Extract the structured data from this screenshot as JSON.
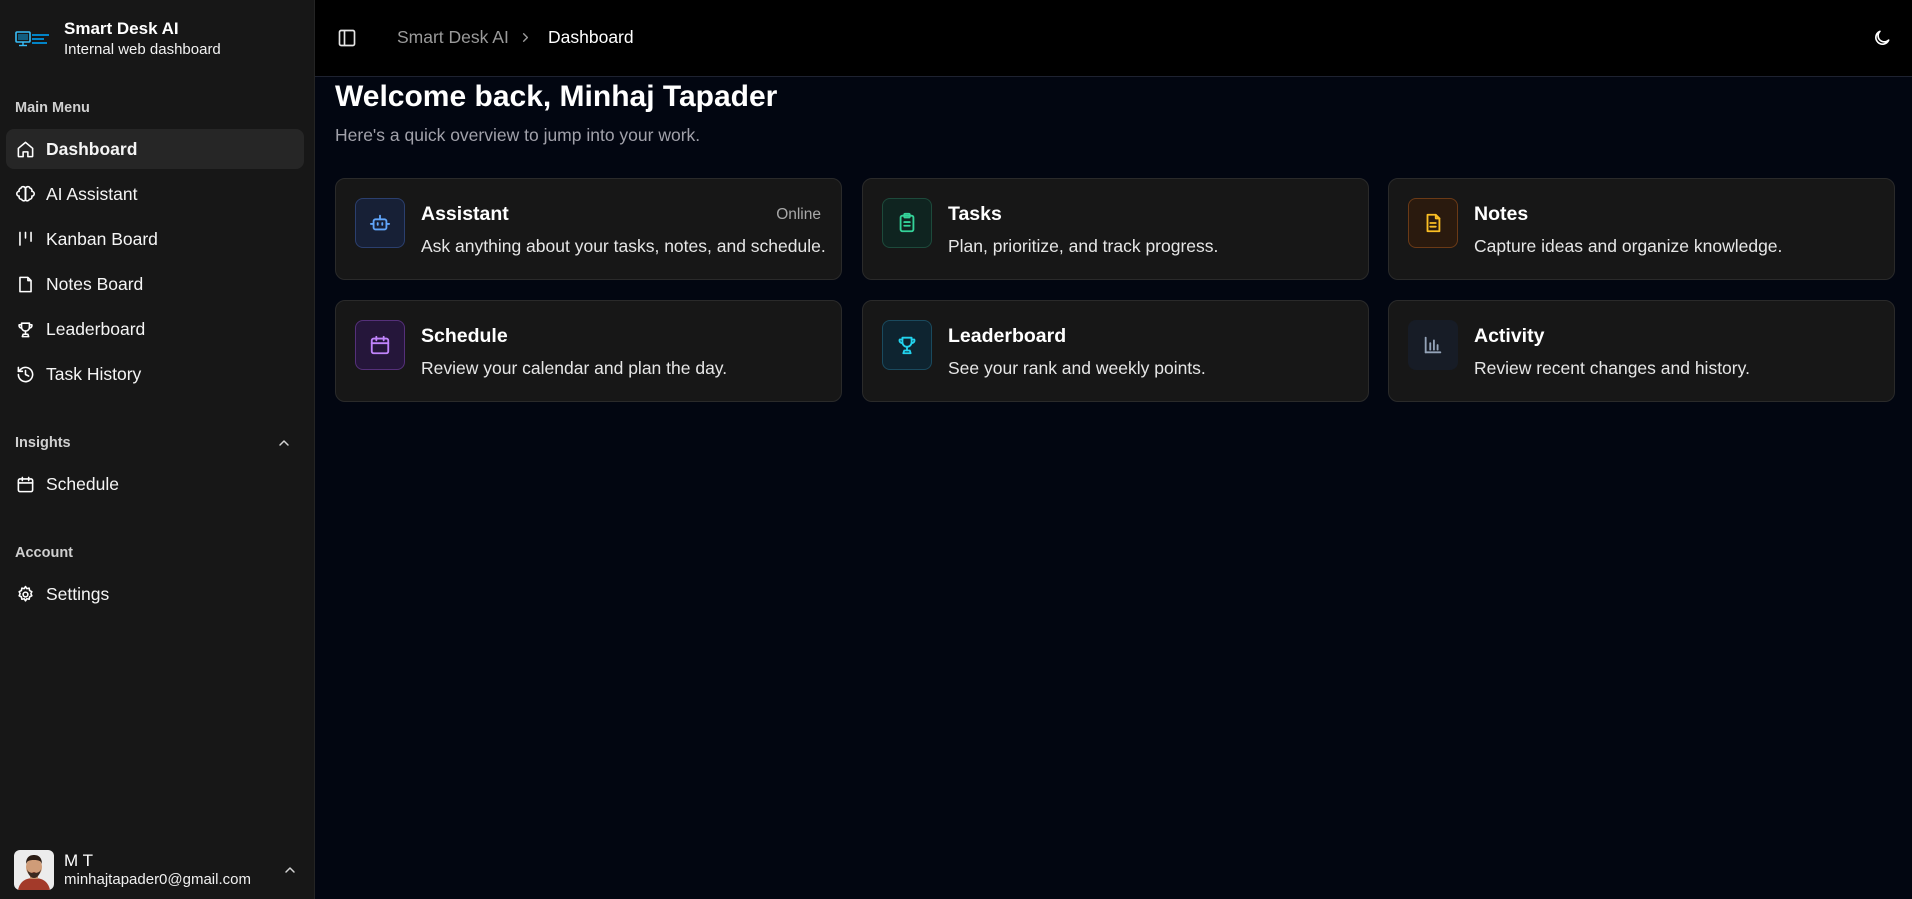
{
  "app": {
    "title": "Smart Desk AI",
    "subtitle": "Internal web dashboard"
  },
  "sidebar": {
    "main_menu_label": "Main Menu",
    "main_items": [
      {
        "label": "Dashboard",
        "icon": "home-icon",
        "active": true
      },
      {
        "label": "AI Assistant",
        "icon": "brain-icon"
      },
      {
        "label": "Kanban Board",
        "icon": "kanban-icon"
      },
      {
        "label": "Notes Board",
        "icon": "note-icon"
      },
      {
        "label": "Leaderboard",
        "icon": "trophy-icon"
      },
      {
        "label": "Task History",
        "icon": "history-icon"
      }
    ],
    "insights_label": "Insights",
    "insights_items": [
      {
        "label": "Schedule",
        "icon": "calendar-icon"
      }
    ],
    "account_label": "Account",
    "account_items": [
      {
        "label": "Settings",
        "icon": "gear-icon"
      }
    ]
  },
  "user": {
    "name": "M T",
    "email": "minhajtapader0@gmail.com"
  },
  "header": {
    "breadcrumb": [
      "Smart Desk AI",
      "Dashboard"
    ]
  },
  "main": {
    "welcome": "Welcome back, Minhaj Tapader",
    "subtitle": "Here's a quick overview to jump into your work.",
    "cards": [
      {
        "title": "Assistant",
        "desc": "Ask anything about your tasks, notes, and schedule.",
        "badge": "Online",
        "icon": "bot-icon",
        "color": "#60a5fa"
      },
      {
        "title": "Tasks",
        "desc": "Plan, prioritize, and track progress.",
        "icon": "clipboard-icon",
        "color": "#34d399"
      },
      {
        "title": "Notes",
        "desc": "Capture ideas and organize knowledge.",
        "icon": "file-text-icon",
        "color": "#fbbf24"
      },
      {
        "title": "Schedule",
        "desc": "Review your calendar and plan the day.",
        "icon": "calendar-icon",
        "color": "#c084fc"
      },
      {
        "title": "Leaderboard",
        "desc": "See your rank and weekly points.",
        "icon": "trophy-icon",
        "color": "#22d3ee"
      },
      {
        "title": "Activity",
        "desc": "Review recent changes and history.",
        "icon": "bar-chart-icon",
        "color": "#94a3b8"
      }
    ]
  },
  "colors": {
    "background": "#020611",
    "sidebar": "#171717",
    "card": "#171717",
    "active_item": "#262626"
  }
}
